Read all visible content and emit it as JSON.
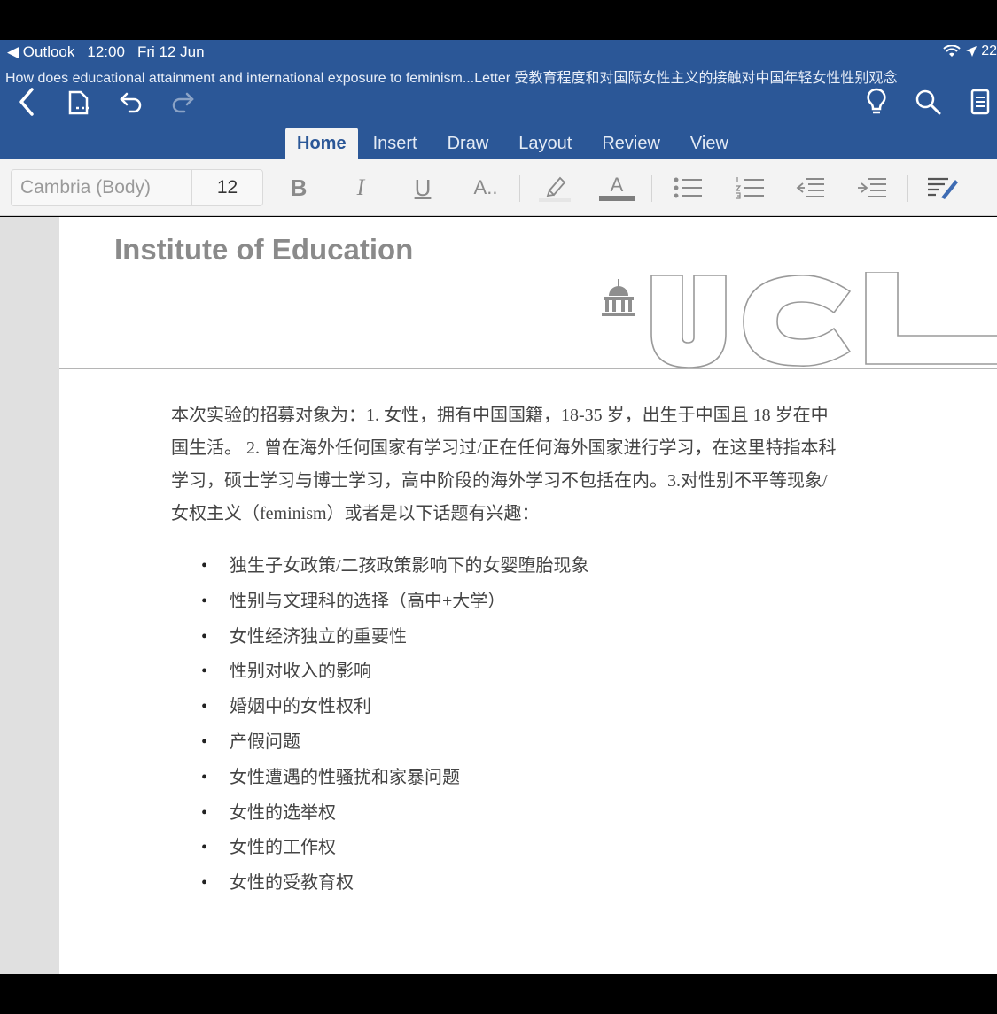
{
  "status_bar": {
    "back_app": "◀ Outlook",
    "time": "12:00",
    "date": "Fri 12 Jun",
    "right": "22"
  },
  "document_title": "How does educational attainment and international exposure to feminism...Letter 受教育程度和对国际女性主义的接触对中国年轻女性性别观念",
  "header_icons": [
    "back-chevron-icon",
    "file-icon",
    "undo-icon",
    "redo-icon",
    "lightbulb-icon",
    "search-icon",
    "reading-view-icon"
  ],
  "tabs": [
    {
      "label": "Home",
      "active": true
    },
    {
      "label": "Insert",
      "active": false
    },
    {
      "label": "Draw",
      "active": false
    },
    {
      "label": "Layout",
      "active": false
    },
    {
      "label": "Review",
      "active": false
    },
    {
      "label": "View",
      "active": false
    }
  ],
  "toolbar": {
    "font_name": "Cambria (Body)",
    "font_size": "12",
    "bold": "B",
    "italic": "I",
    "underline": "U",
    "font_style": "A..",
    "font_color": "A"
  },
  "colors": {
    "header_blue": "#2b5797",
    "toolbar_bg": "#f3f3f3",
    "page_bg": "#ffffff",
    "gutter": "#e0e0e0"
  },
  "document": {
    "institute": "Institute of Education",
    "logo_text": "UCL",
    "paragraph": [
      "本次实验的招募对象为：1. 女性，拥有中国国籍，18-35 岁，出生于中国且 18 岁在中",
      "国生活。 2. 曾在海外任何国家有学习过/正在任何海外国家进行学习，在这里特指本科",
      "学习，硕士学习与博士学习，高中阶段的海外学习不包括在内。3.对性别不平等现象/",
      "女权主义（feminism）或者是以下话题有兴趣："
    ],
    "bullets": [
      "独生子女政策/二孩政策影响下的女婴堕胎现象",
      "性别与文理科的选择（高中+大学）",
      "女性经济独立的重要性",
      "性别对收入的影响",
      "婚姻中的女性权利",
      "产假问题",
      "女性遭遇的性骚扰和家暴问题",
      "女性的选举权",
      "女性的工作权",
      "女性的受教育权"
    ]
  }
}
